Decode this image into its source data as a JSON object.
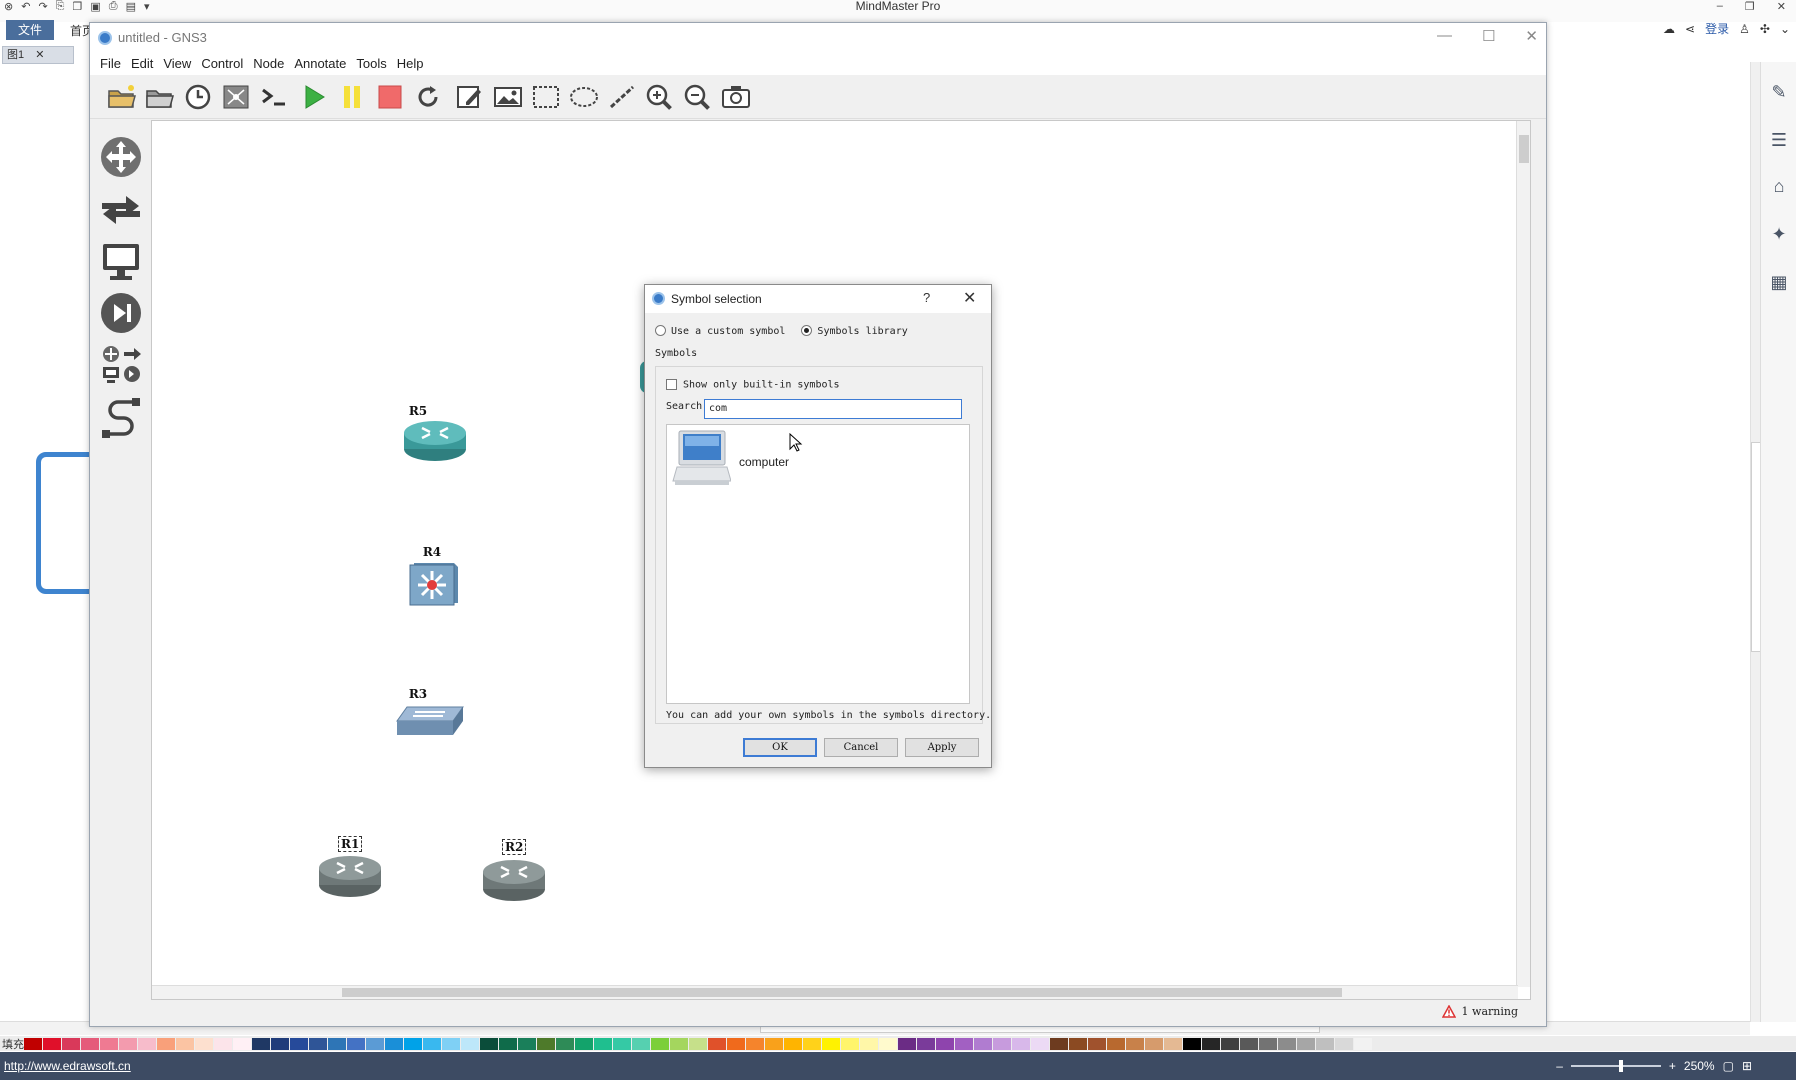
{
  "mindmaster": {
    "app_title": "MindMaster Pro",
    "file_tab": "文件",
    "home_tab": "首页",
    "doc_tab": "图1",
    "login_label": "登录",
    "status_url": "http://www.edrawsoft.cn",
    "zoom_level": "250%",
    "fill_label": "填充",
    "palette": [
      "#c00000",
      "#e0102a",
      "#d9395a",
      "#e55b7a",
      "#ef7a92",
      "#f39bae",
      "#f7bccb",
      "#f9a07a",
      "#fbc4a3",
      "#fde0cf",
      "#fce4ea",
      "#fff0f5",
      "#1f3864",
      "#203c7a",
      "#264a9a",
      "#2f5597",
      "#2e75b6",
      "#4472c4",
      "#5b9bd5",
      "#1a8fd8",
      "#00a2e8",
      "#39b8ef",
      "#7fd0f5",
      "#bde7fa",
      "#0b4d3a",
      "#0f6b4a",
      "#1a7f5a",
      "#4e7a2a",
      "#2e8b57",
      "#13a36b",
      "#1fbf8f",
      "#35c9a5",
      "#56d0b0",
      "#7ccf3a",
      "#a4d65e",
      "#c6e08a",
      "#e0512a",
      "#f06a1c",
      "#f5842c",
      "#f9a11b",
      "#ffb400",
      "#ffd21a",
      "#fff200",
      "#fff56b",
      "#fff7a8",
      "#fffacd",
      "#6b2c85",
      "#7a3b9a",
      "#8e44ad",
      "#a260c2",
      "#b07cd0",
      "#c79bdd",
      "#d8b8ea",
      "#ecdaf5",
      "#6d3b1f",
      "#8b4a22",
      "#a0522d",
      "#b8692f",
      "#c8814a",
      "#d69b6c",
      "#e4b993",
      "#000000",
      "#262626",
      "#404040",
      "#595959",
      "#737373",
      "#8c8c8c",
      "#a6a6a6",
      "#bfbfbf",
      "#d9d9d9",
      "#f2f2f2"
    ]
  },
  "gns3": {
    "window_title": "untitled - GNS3",
    "menu": [
      "File",
      "Edit",
      "View",
      "Control",
      "Node",
      "Annotate",
      "Tools",
      "Help"
    ],
    "toolbar_icons": [
      "open-folder-icon",
      "open-icon",
      "clock-icon",
      "topology-icon",
      "console-icon",
      "start-icon",
      "pause-icon",
      "stop-icon",
      "reload-icon",
      "edit-note-icon",
      "insert-picture-icon",
      "draw-rectangle-icon",
      "draw-ellipse-icon",
      "draw-line-icon",
      "zoom-in-icon",
      "zoom-out-icon",
      "screenshot-icon"
    ],
    "left_icons": [
      "move-icon",
      "switches-icon",
      "end-devices-icon",
      "security-devices-icon",
      "all-devices-icon",
      "add-link-icon"
    ],
    "nodes": [
      {
        "label": "R5"
      },
      {
        "label": "R4"
      },
      {
        "label": "R3"
      },
      {
        "label": "R1"
      },
      {
        "label": "R2"
      }
    ],
    "warning_text": "1 warning"
  },
  "dialog": {
    "title": "Symbol selection",
    "help_glyph": "?",
    "close_glyph": "✕",
    "radio_custom": "Use a custom symbol",
    "radio_library": "Symbols library",
    "symbols_label": "Symbols",
    "checkbox_builtin": "Show only built-in symbols",
    "search_label": "Search:",
    "search_value": "com",
    "result_item": "computer",
    "hint": "You can add your own symbols in the symbols directory.",
    "ok": "OK",
    "cancel": "Cancel",
    "apply": "Apply"
  }
}
